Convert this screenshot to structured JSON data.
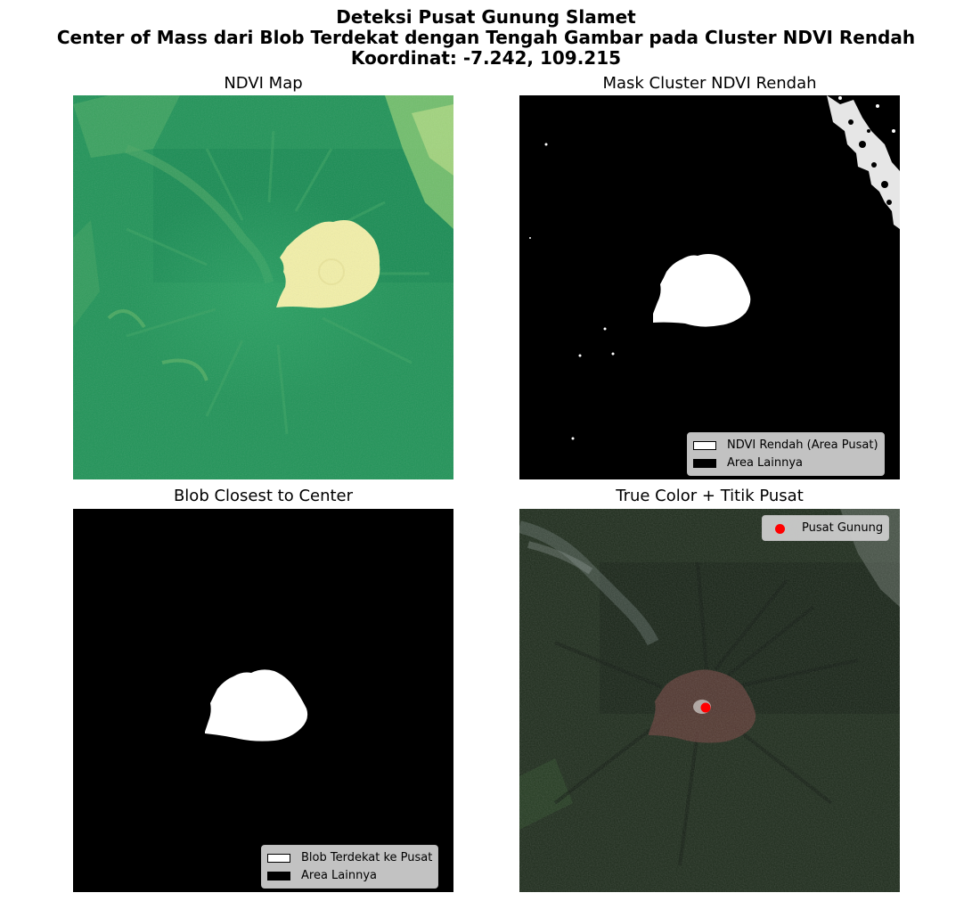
{
  "suptitle": {
    "line1": "Deteksi Pusat Gunung Slamet",
    "line2": "Center of Mass dari Blob Terdekat dengan Tengah Gambar pada Cluster NDVI Rendah",
    "line3": "Koordinat: -7.242, 109.215"
  },
  "panels": {
    "ndvi": {
      "title": "NDVI Map"
    },
    "mask": {
      "title": "Mask Cluster NDVI Rendah",
      "legend": [
        "NDVI Rendah (Area Pusat)",
        "Area Lainnya"
      ]
    },
    "blob": {
      "title": "Blob Closest to Center",
      "legend": [
        "Blob Terdekat ke Pusat",
        "Area Lainnya"
      ]
    },
    "truecolor": {
      "title": "True Color + Titik Pusat",
      "legend": [
        "Pusat Gunung"
      ]
    }
  },
  "colors": {
    "ndvi_base": "#1f9357",
    "ndvi_low": "#f3f0a8",
    "mask_fg": "#ffffff",
    "mask_bg": "#000000",
    "tc_base": "#1c2a1a",
    "tc_summit": "#5a3a34",
    "center_marker": "#ff0000"
  }
}
